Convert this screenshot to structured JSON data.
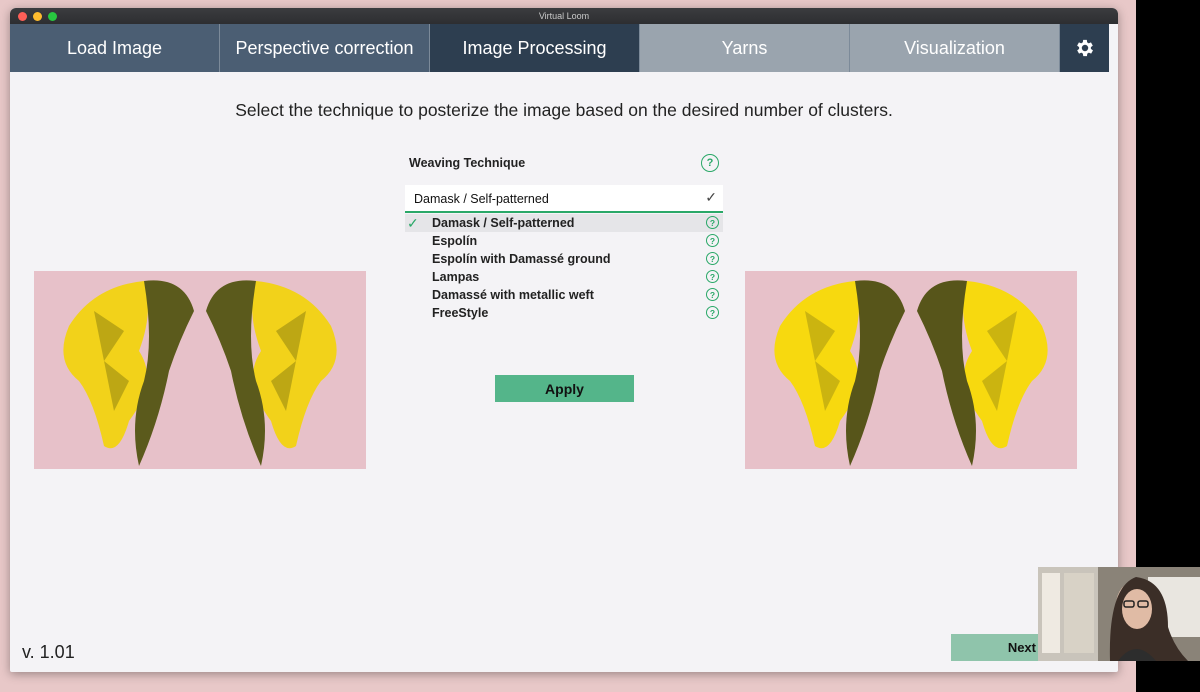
{
  "window": {
    "title": "Virtual Loom"
  },
  "tabs": [
    {
      "label": "Load Image",
      "state": "normal"
    },
    {
      "label": "Perspective correction",
      "state": "normal"
    },
    {
      "label": "Image Processing",
      "state": "active"
    },
    {
      "label": "Yarns",
      "state": "disabled"
    },
    {
      "label": "Visualization",
      "state": "disabled"
    }
  ],
  "settings_icon": "gear-icon",
  "instruction": "Select the technique to posterize the image based on the desired number of clusters.",
  "weaving": {
    "label": "Weaving Technique",
    "help_icon": "question-circle-icon",
    "selected": "Damask / Self-patterned",
    "options": [
      "Damask / Self-patterned",
      "Espolín",
      "Espolín with Damassé ground",
      "Lampas",
      "Damassé with metallic weft",
      "FreeStyle"
    ]
  },
  "apply_label": "Apply",
  "version": "v. 1.01",
  "next_label": "Next",
  "colors": {
    "accent": "#2aa868",
    "button": "#54b58a",
    "tab_active": "#2d3e50",
    "tab_normal": "#4b5e73",
    "tab_disabled": "#9aa4ae"
  }
}
